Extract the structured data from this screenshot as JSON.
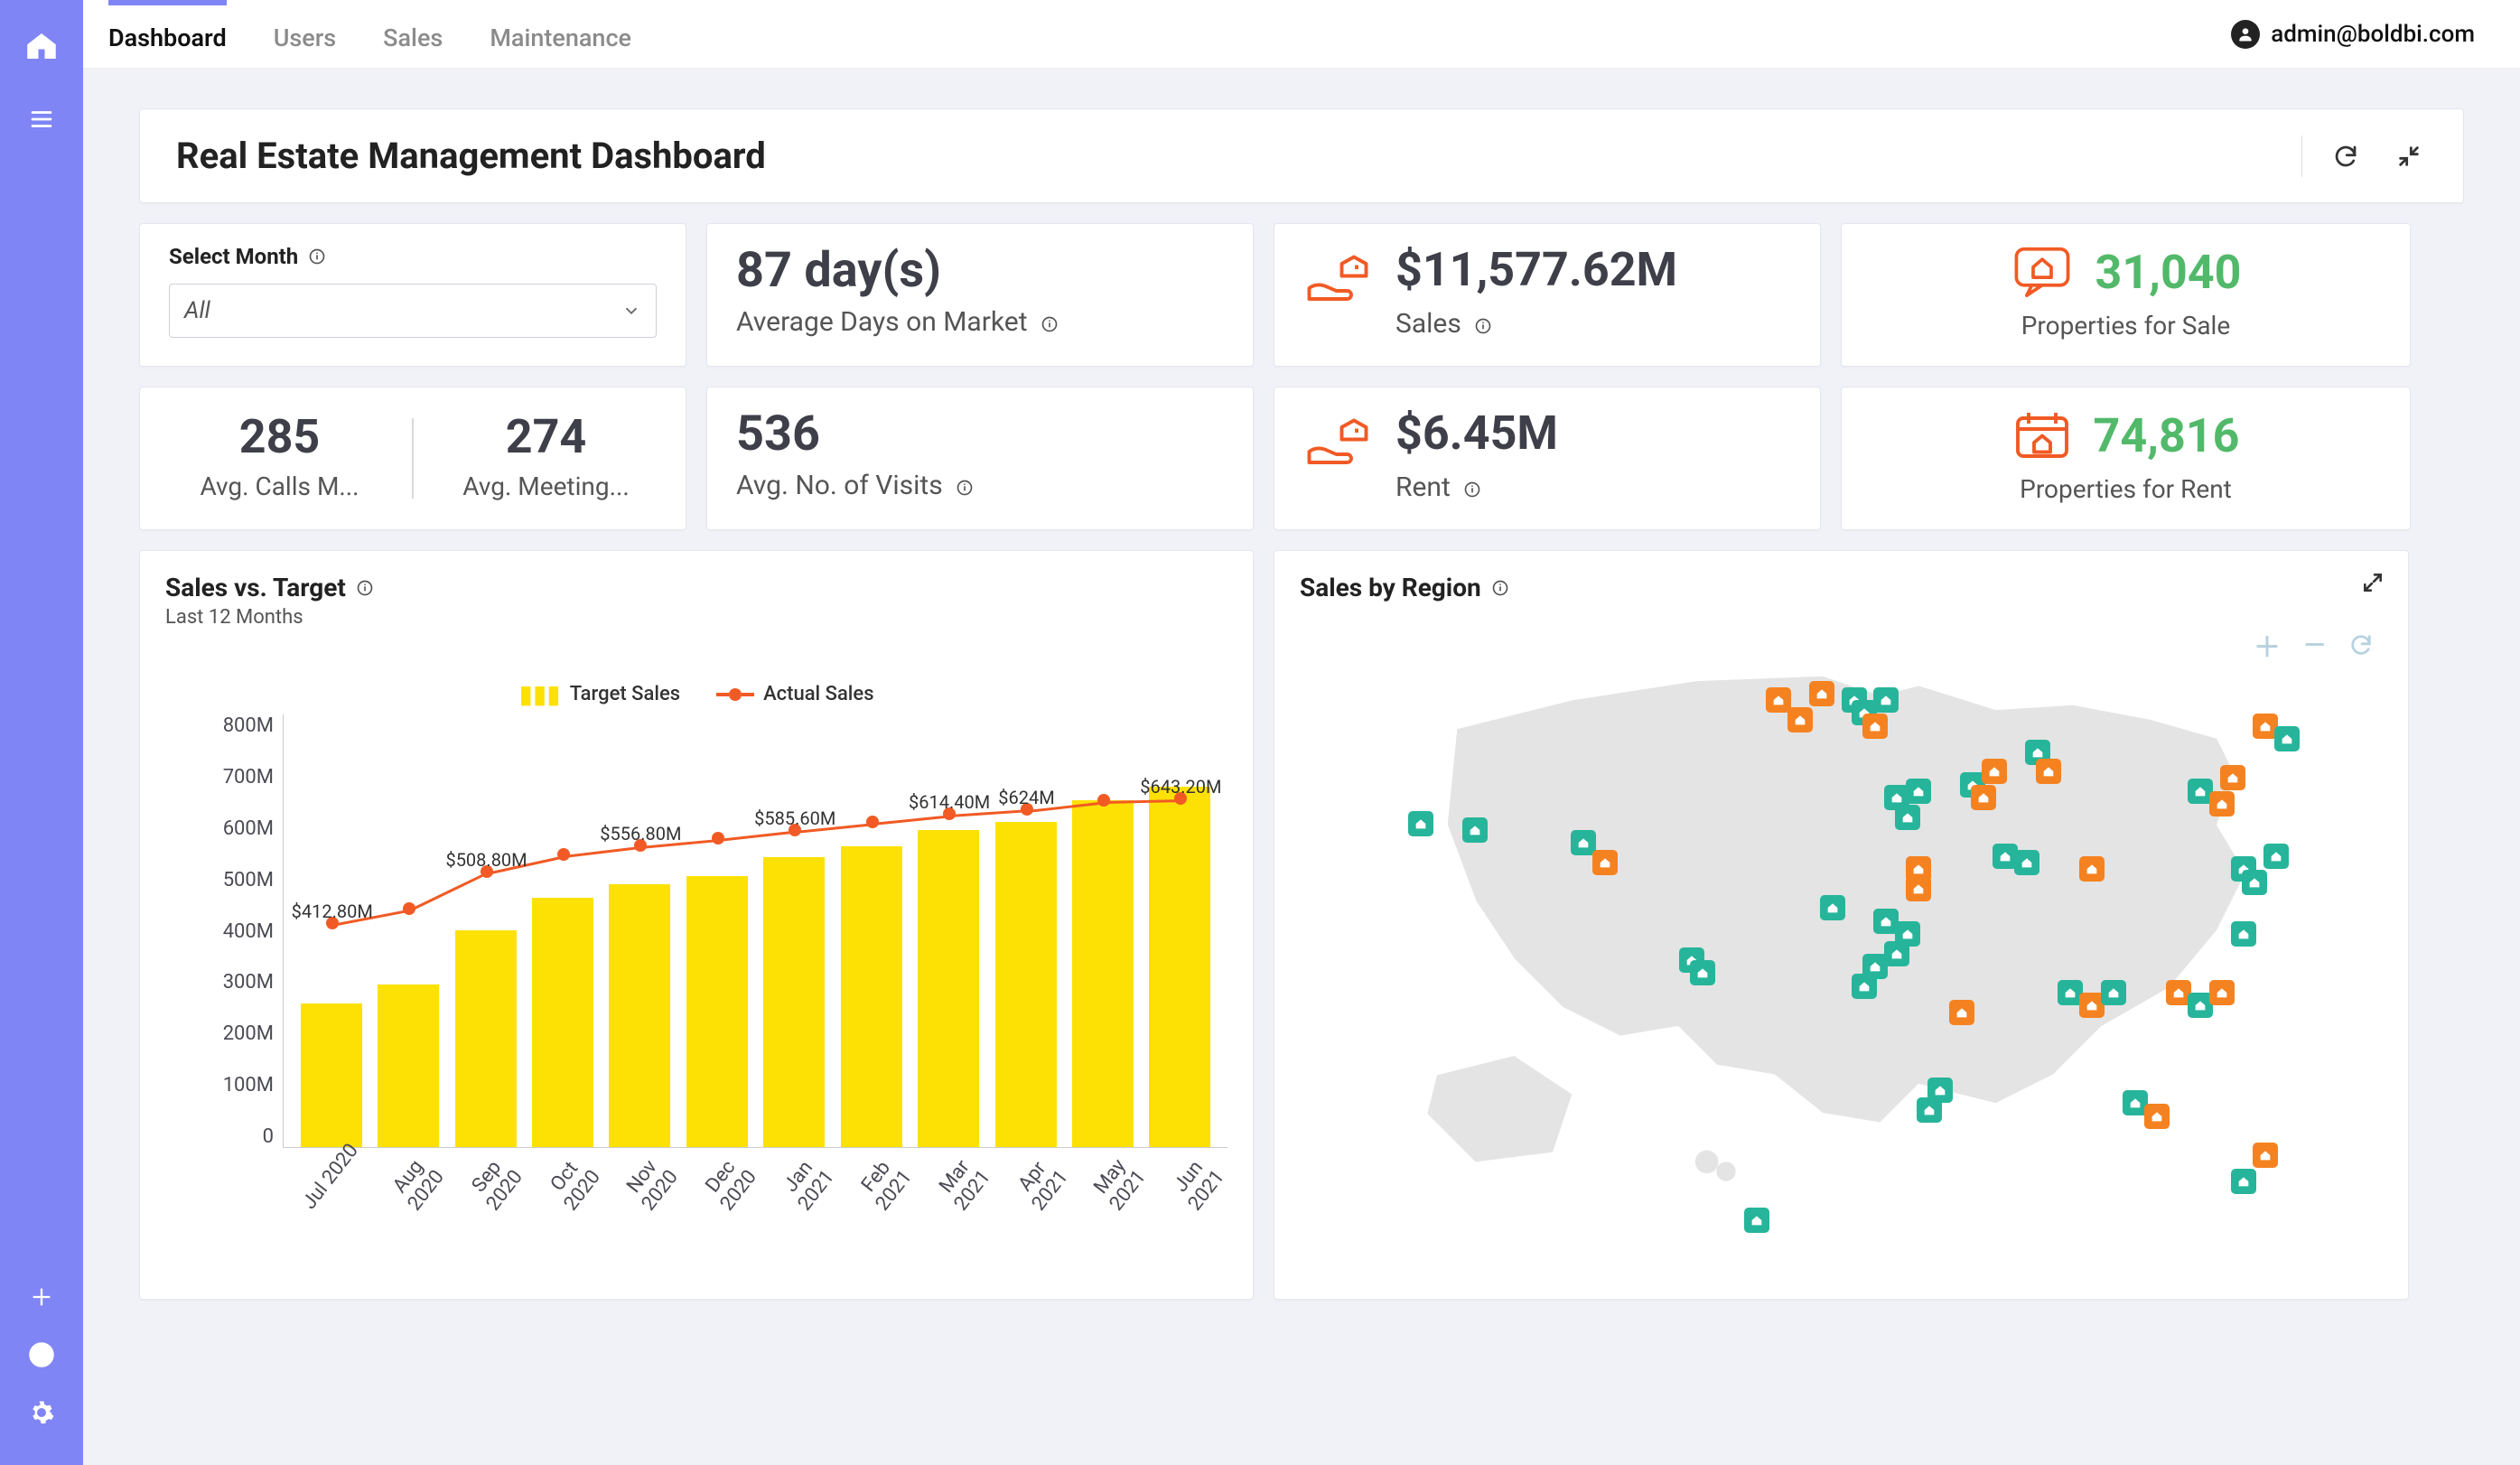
{
  "nav": {
    "tabs": [
      "Dashboard",
      "Users",
      "Sales",
      "Maintenance"
    ],
    "active_tab_index": 0,
    "user_email": "admin@boldbi.com"
  },
  "header": {
    "title": "Real Estate Management Dashboard"
  },
  "filter": {
    "label": "Select Month",
    "value": "All"
  },
  "kpis": {
    "avg_days_value": "87 day(s)",
    "avg_days_label": "Average Days on Market",
    "sales_value": "$11,577.62M",
    "sales_label": "Sales",
    "props_sale_value": "31,040",
    "props_sale_label": "Properties for Sale",
    "calls_value": "285",
    "calls_label": "Avg. Calls M...",
    "meetings_value": "274",
    "meetings_label": "Avg. Meeting...",
    "visits_value": "536",
    "visits_label": "Avg. No. of Visits",
    "rent_value": "$6.45M",
    "rent_label": "Rent",
    "props_rent_value": "74,816",
    "props_rent_label": "Properties for Rent"
  },
  "chart_sales_target": {
    "title": "Sales vs. Target",
    "subtitle": "Last 12 Months",
    "legend": {
      "bars": "Target Sales",
      "line": "Actual Sales"
    }
  },
  "chart_region": {
    "title": "Sales by Region"
  },
  "colors": {
    "accent": "#7f85f5",
    "bar": "#fde104",
    "line": "#f15a24",
    "kpi_green": "#52b96a",
    "kpi_orange": "#f15a24",
    "marker_green": "#26b59a",
    "marker_orange": "#f58220"
  },
  "chart_data": {
    "type": "bar",
    "title": "Sales vs. Target — Last 12 Months",
    "xlabel": "",
    "ylabel": "",
    "ylim": [
      0,
      800
    ],
    "y_ticks": [
      "800M",
      "700M",
      "600M",
      "500M",
      "400M",
      "300M",
      "200M",
      "100M",
      "0"
    ],
    "categories": [
      "Jul 2020",
      "Aug 2020",
      "Sep 2020",
      "Oct 2020",
      "Nov 2020",
      "Dec 2020",
      "Jan 2021",
      "Feb 2021",
      "Mar 2021",
      "Apr 2021",
      "May 2021",
      "Jun 2021"
    ],
    "series": [
      {
        "name": "Target Sales",
        "type": "bar",
        "values": [
          265,
          300,
          400,
          460,
          485,
          500,
          535,
          555,
          585,
          600,
          640,
          665
        ]
      },
      {
        "name": "Actual Sales",
        "type": "line",
        "values": [
          412.8,
          440,
          508.8,
          540,
          556.8,
          570,
          585.6,
          600,
          614.4,
          624,
          640,
          643.2
        ]
      }
    ],
    "line_point_labels": [
      "$412.80M",
      "",
      "$508.80M",
      "",
      "$556.80M",
      "",
      "$585.60M",
      "",
      "$614.40M",
      "$624M",
      "",
      "$643.20M"
    ]
  }
}
